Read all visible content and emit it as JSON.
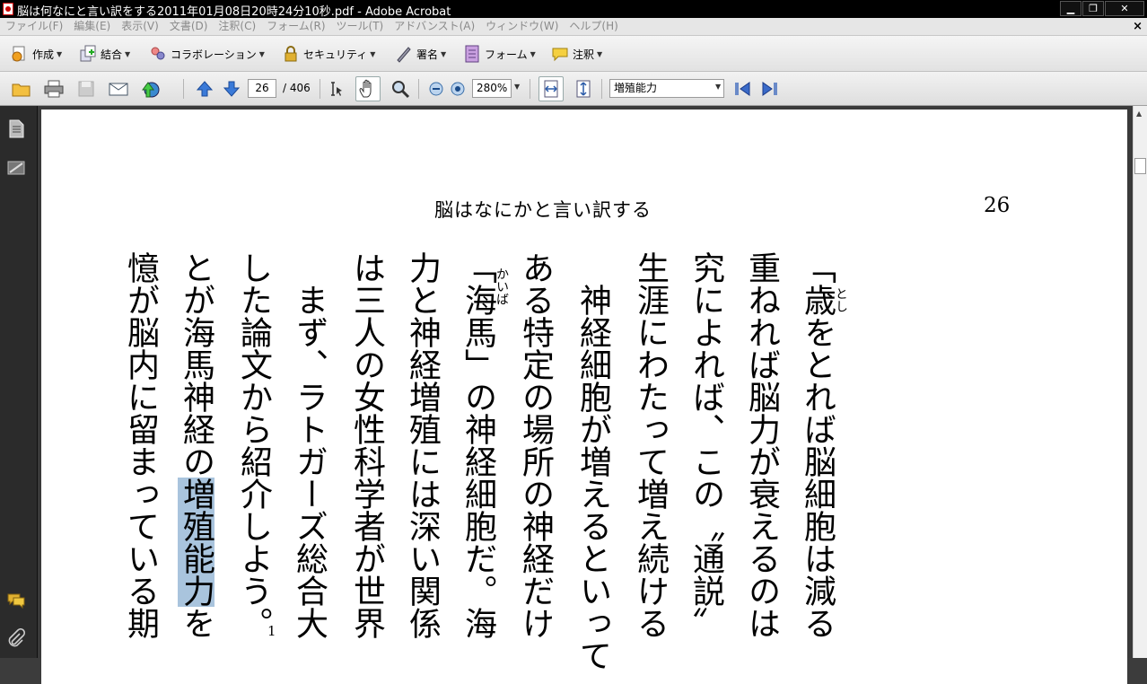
{
  "window": {
    "title": "脳は何なにと言い訳をする2011年01月08日20時24分10秒.pdf - Adobe Acrobat",
    "min_label": "▁",
    "restore_label": "❐",
    "close_label": "✕"
  },
  "menu": {
    "items": [
      "ファイル(F)",
      "編集(E)",
      "表示(V)",
      "文書(D)",
      "注釈(C)",
      "フォーム(R)",
      "ツール(T)",
      "アドバンスト(A)",
      "ウィンドウ(W)",
      "ヘルプ(H)"
    ],
    "close_doc": "×"
  },
  "tasks": {
    "create": "作成",
    "combine": "結合",
    "collaborate": "コラボレーション",
    "security": "セキュリティ",
    "sign": "署名",
    "forms": "フォーム",
    "comment": "注釈"
  },
  "nav": {
    "page_current": "26",
    "page_total": "/ 406",
    "zoom": "280%",
    "search": "増殖能力"
  },
  "page": {
    "header": "脳はなにかと言い訳する",
    "number": "26",
    "columns": [
      "「歳をとれば脳細胞は減る",
      "重ねれば脳力が衰えるのは",
      "究によれば、この〝通説〟",
      "生涯にわたって増え続ける",
      "　神経細胞が増えるといって",
      "ある特定の場所の神経だけ",
      "「海馬」の神経細胞だ。海",
      "力と神経増殖には深い関係",
      "は三人の女性科学者が世界",
      "　まず、ラトガーズ総合大",
      "した論文から紹介しよう。",
      "とが海馬神経の",
      "憶が脳内に留まっている期"
    ],
    "highlight": "増殖能力",
    "after_highlight": "を",
    "ruby_toshi": "とし",
    "ruby_kaiba": "かいば",
    "footnote": "1"
  },
  "colors": {
    "highlight": "#a9c4dd",
    "titlebar": "#000000"
  }
}
